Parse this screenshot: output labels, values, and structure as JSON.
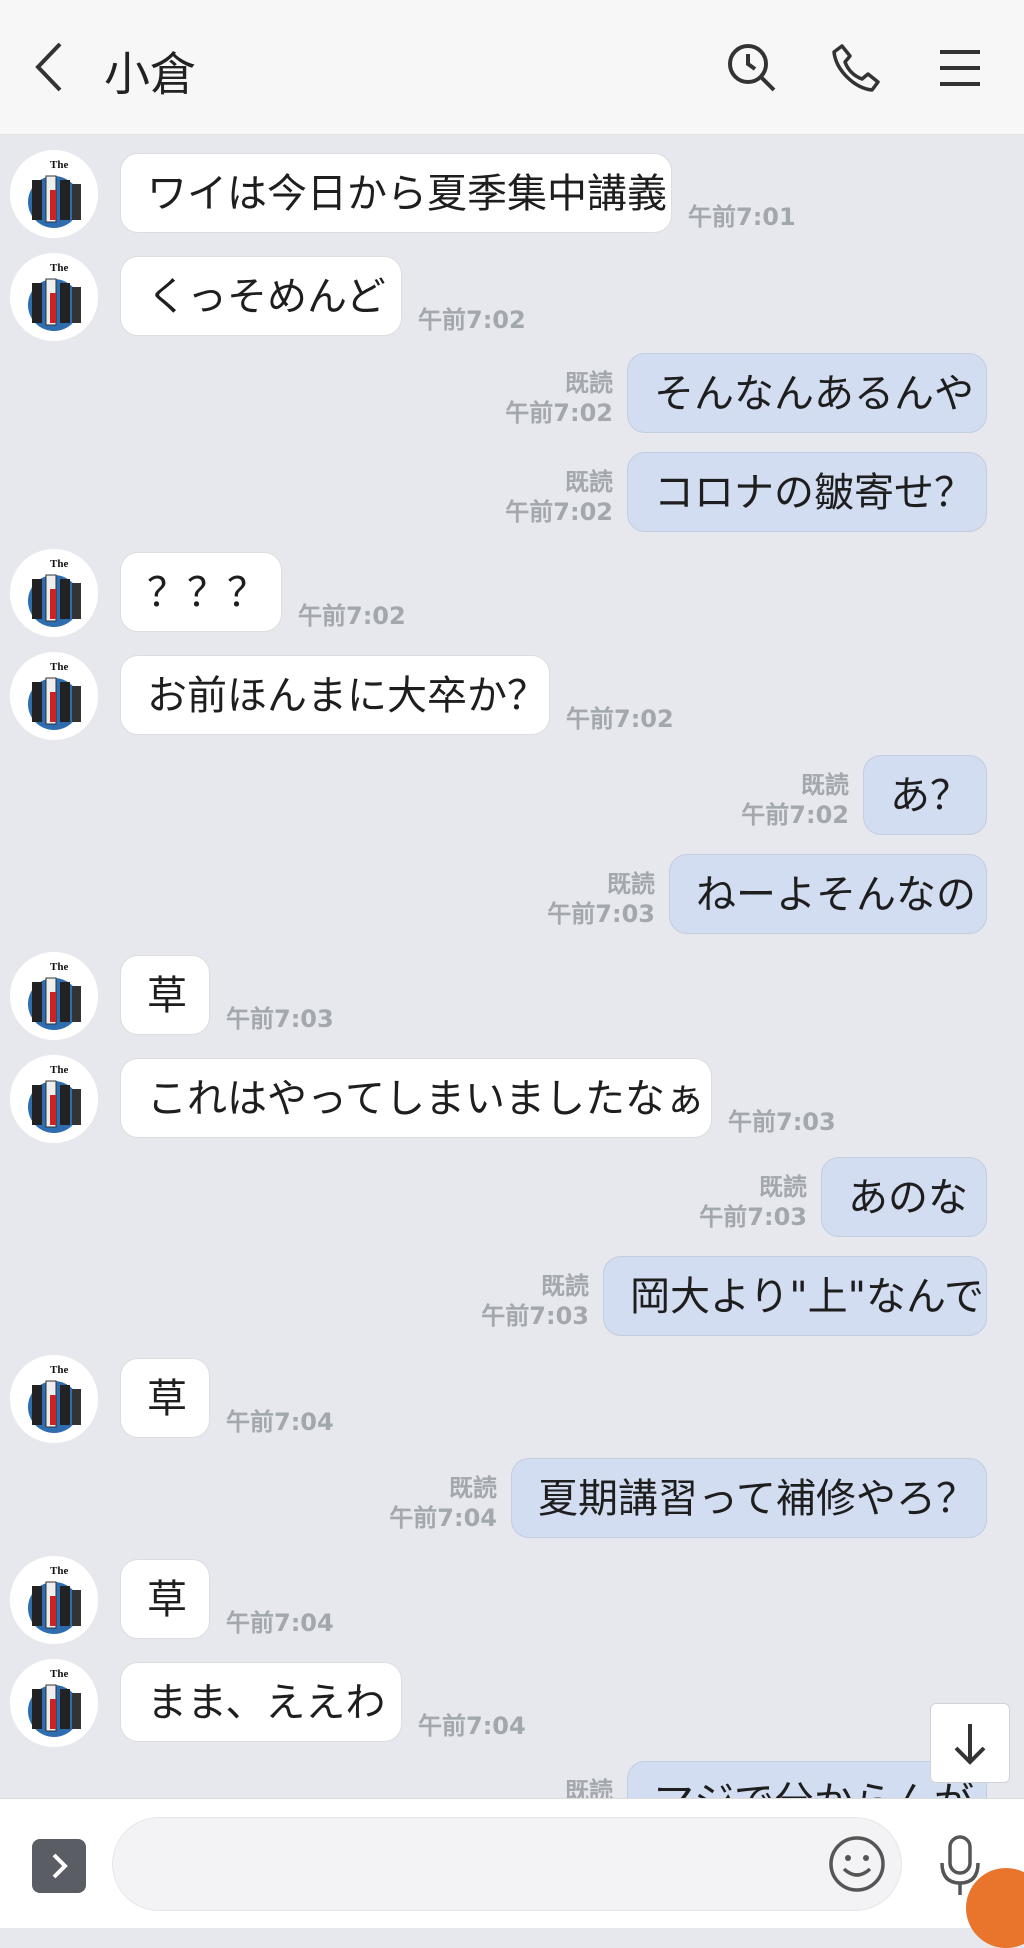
{
  "header": {
    "title": "小倉",
    "back_icon": "chevron-left-icon",
    "search_icon": "search-icon",
    "call_icon": "phone-icon",
    "menu_icon": "menu-icon"
  },
  "messages": [
    {
      "side": "in",
      "text": "ワイは今日から夏季集中講義",
      "time": "午前7:01"
    },
    {
      "side": "in",
      "text": "くっそめんど",
      "time": "午前7:02"
    },
    {
      "side": "out",
      "text": "そんなんあるんや",
      "time": "午前7:02",
      "read": "既読"
    },
    {
      "side": "out",
      "text": "コロナの皺寄せ？",
      "time": "午前7:02",
      "read": "既読"
    },
    {
      "side": "in",
      "text": "？？？",
      "time": "午前7:02"
    },
    {
      "side": "in",
      "text": "お前ほんまに大卒か？",
      "time": "午前7:02"
    },
    {
      "side": "out",
      "text": "あ？",
      "time": "午前7:02",
      "read": "既読"
    },
    {
      "side": "out",
      "text": "ねーよそんなの",
      "time": "午前7:03",
      "read": "既読"
    },
    {
      "side": "in",
      "text": "草",
      "time": "午前7:03"
    },
    {
      "side": "in",
      "text": "これはやってしまいましたなぁ",
      "time": "午前7:03"
    },
    {
      "side": "out",
      "text": "あのな",
      "time": "午前7:03",
      "read": "既読"
    },
    {
      "side": "out",
      "text": "岡大より\"上\"なんで",
      "time": "午前7:03",
      "read": "既読"
    },
    {
      "side": "in",
      "text": "草",
      "time": "午前7:04"
    },
    {
      "side": "out",
      "text": "夏期講習って補修やろ？",
      "time": "午前7:04",
      "read": "既読"
    },
    {
      "side": "in",
      "text": "草",
      "time": "午前7:04"
    },
    {
      "side": "in",
      "text": "まま、ええわ",
      "time": "午前7:04"
    },
    {
      "side": "out",
      "text": "マジで分からんが",
      "read": "既読"
    }
  ],
  "footer": {
    "expand_icon": "chevron-right-icon",
    "emoji_icon": "emoji-icon",
    "mic_icon": "microphone-icon"
  },
  "scroll_icon": "arrow-down-icon",
  "colors": {
    "background": "#e6e8ed",
    "incoming_bubble": "#ffffff",
    "outgoing_bubble": "#d3ddf1",
    "timestamp": "#a3a7ae",
    "accent": "#e8752b"
  }
}
